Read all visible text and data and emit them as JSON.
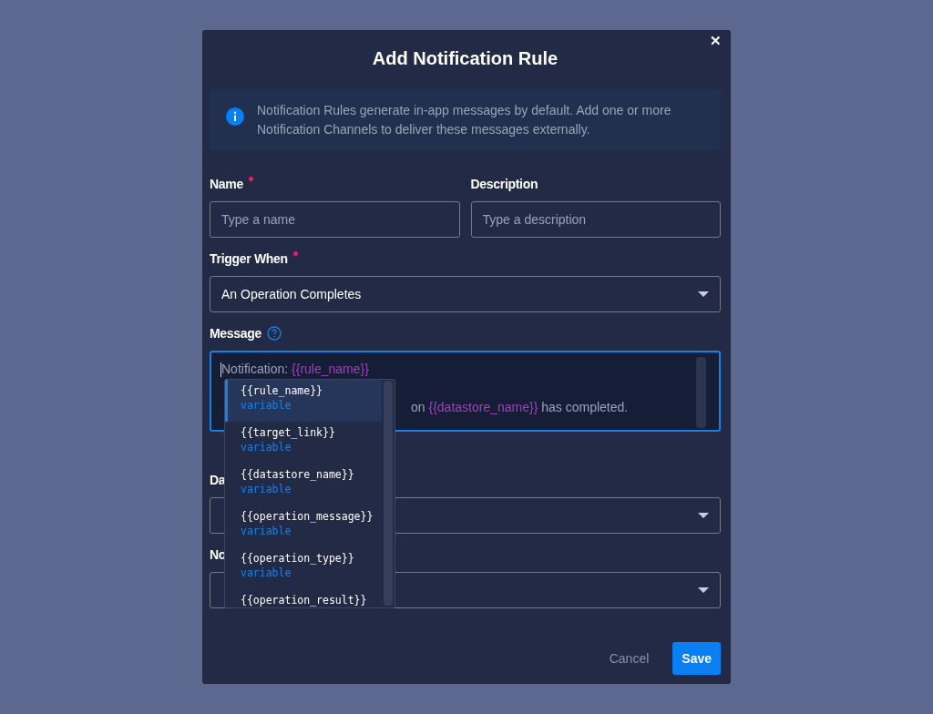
{
  "dialog": {
    "title": "Add Notification Rule",
    "close": "✕"
  },
  "info": {
    "text": "Notification Rules generate in-app messages by default. Add one or more Notification Channels to deliver these messages externally."
  },
  "name_field": {
    "label": "Name",
    "required": true,
    "placeholder": "Type a name"
  },
  "description_field": {
    "label": "Description",
    "placeholder": "Type a description"
  },
  "trigger_field": {
    "label": "Trigger When",
    "required": true,
    "value": "An Operation Completes"
  },
  "message_field": {
    "label": "Message",
    "focused": true,
    "lines": [
      [
        {
          "kind": "plain",
          "text": "Notification: "
        },
        {
          "kind": "variable",
          "text": "{{rule_name}}"
        }
      ],
      [
        {
          "kind": "plain",
          "text": "on "
        },
        {
          "kind": "variable",
          "text": "{{datastore_name}}"
        },
        {
          "kind": "plain",
          "text": " has completed."
        }
      ]
    ]
  },
  "autocomplete": {
    "items": [
      {
        "name": "{{rule_name}}",
        "type": "variable",
        "selected": true
      },
      {
        "name": "{{target_link}}",
        "type": "variable",
        "selected": false
      },
      {
        "name": "{{datastore_name}}",
        "type": "variable",
        "selected": false
      },
      {
        "name": "{{operation_message}}",
        "type": "variable",
        "selected": false
      },
      {
        "name": "{{operation_type}}",
        "type": "variable",
        "selected": false
      },
      {
        "name": "{{operation_result}}",
        "selected": false
      }
    ]
  },
  "select_fields": [
    {
      "label": "Da"
    },
    {
      "label": "No"
    }
  ],
  "buttons": [
    {
      "kind": "secondary",
      "label": "Cancel"
    },
    {
      "kind": "primary",
      "label": "Save"
    }
  ]
}
